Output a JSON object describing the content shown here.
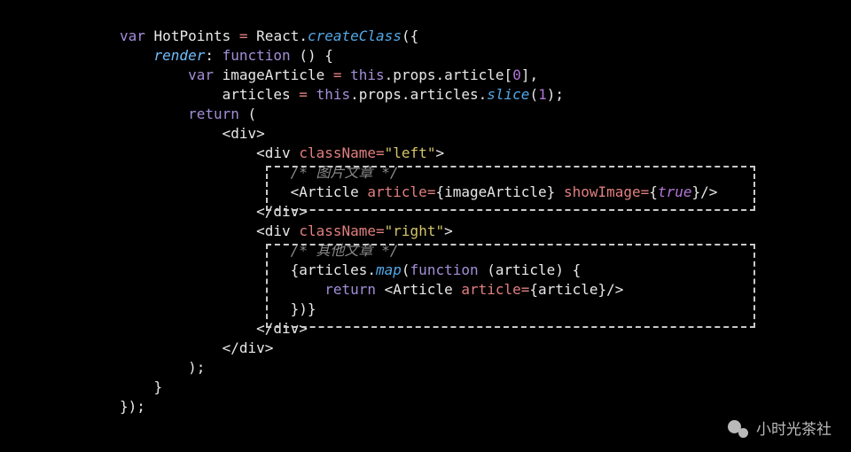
{
  "code": {
    "l1": {
      "kw_var": "var",
      "name": "HotPoints",
      "op": "=",
      "react": "React",
      "dot": ".",
      "fn": "createClass",
      "open": "({"
    },
    "l2": {
      "prop": "render",
      "colon": ":",
      "kw_fn": "function",
      "parens": "()",
      "brace": "{"
    },
    "l3": {
      "kw_var": "var",
      "name": "imageArticle",
      "op": "=",
      "this": "this",
      "dot": ".",
      "props": "props",
      "dot2": ".",
      "article": "article",
      "lb": "[",
      "idx": "0",
      "rb": "],",
      "comma": ""
    },
    "l4": {
      "name": "articles",
      "op": "=",
      "this": "this",
      "dot": ".",
      "props": "props",
      "dot2": ".",
      "articles": "articles",
      "dot3": ".",
      "fn": "slice",
      "lp": "(",
      "n": "1",
      "rp": ");"
    },
    "l5": {
      "kw": "return",
      "lp": "("
    },
    "l6": {
      "open": "<",
      "tag": "div",
      "close": ">"
    },
    "l7": {
      "open": "<",
      "tag": "div",
      "sp": " ",
      "attr": "className",
      "eq": "=",
      "val": "\"left\"",
      "close": ">"
    },
    "l8": {
      "cmt": "/* 图片文章 */"
    },
    "l9": {
      "open": "<",
      "tag": "Article",
      "sp": " ",
      "a1": "article",
      "eq1": "=",
      "b1": "{imageArticle}",
      "sp2": " ",
      "a2": "showImage",
      "eq2": "=",
      "b2o": "{",
      "tv": "true",
      "b2c": "}",
      "close": "/>"
    },
    "l10": {
      "open": "</",
      "tag": "div",
      "close": ">"
    },
    "l11": {
      "open": "<",
      "tag": "div",
      "sp": " ",
      "attr": "className",
      "eq": "=",
      "val": "\"right\"",
      "close": ">"
    },
    "l12": {
      "cmt": "/* 其他文章 */"
    },
    "l13": {
      "ob": "{",
      "name": "articles",
      "dot": ".",
      "fn": "map",
      "lp": "(",
      "kw": "function",
      "sp": " ",
      "args": "(article)",
      "br": " {"
    },
    "l14": {
      "kw": "return",
      "sp": " ",
      "open": "<",
      "tag": "Article",
      "sp2": " ",
      "attr": "article",
      "eq": "=",
      "val": "{article}",
      "close": "/>"
    },
    "l15": {
      "txt": "})}"
    },
    "l16": {
      "open": "</",
      "tag": "div",
      "close": ">"
    },
    "l17": {
      "open": "</",
      "tag": "div",
      "close": ">"
    },
    "l18": {
      "txt": ");"
    },
    "l19": {
      "txt": "}"
    },
    "l20": {
      "txt": "});"
    }
  },
  "watermark": {
    "text": "小时光茶社"
  }
}
